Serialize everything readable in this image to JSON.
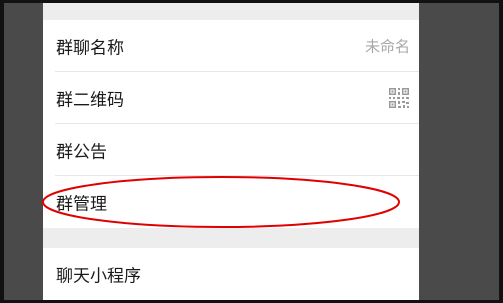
{
  "settings_group": {
    "items": [
      {
        "label": "群聊名称",
        "value": "未命名"
      },
      {
        "label": "群二维码"
      },
      {
        "label": "群公告"
      },
      {
        "label": "群管理"
      }
    ]
  },
  "second_group": {
    "items": [
      {
        "label": "聊天小程序"
      }
    ]
  },
  "annotation": {
    "color": "#e00000",
    "target": "群管理"
  }
}
